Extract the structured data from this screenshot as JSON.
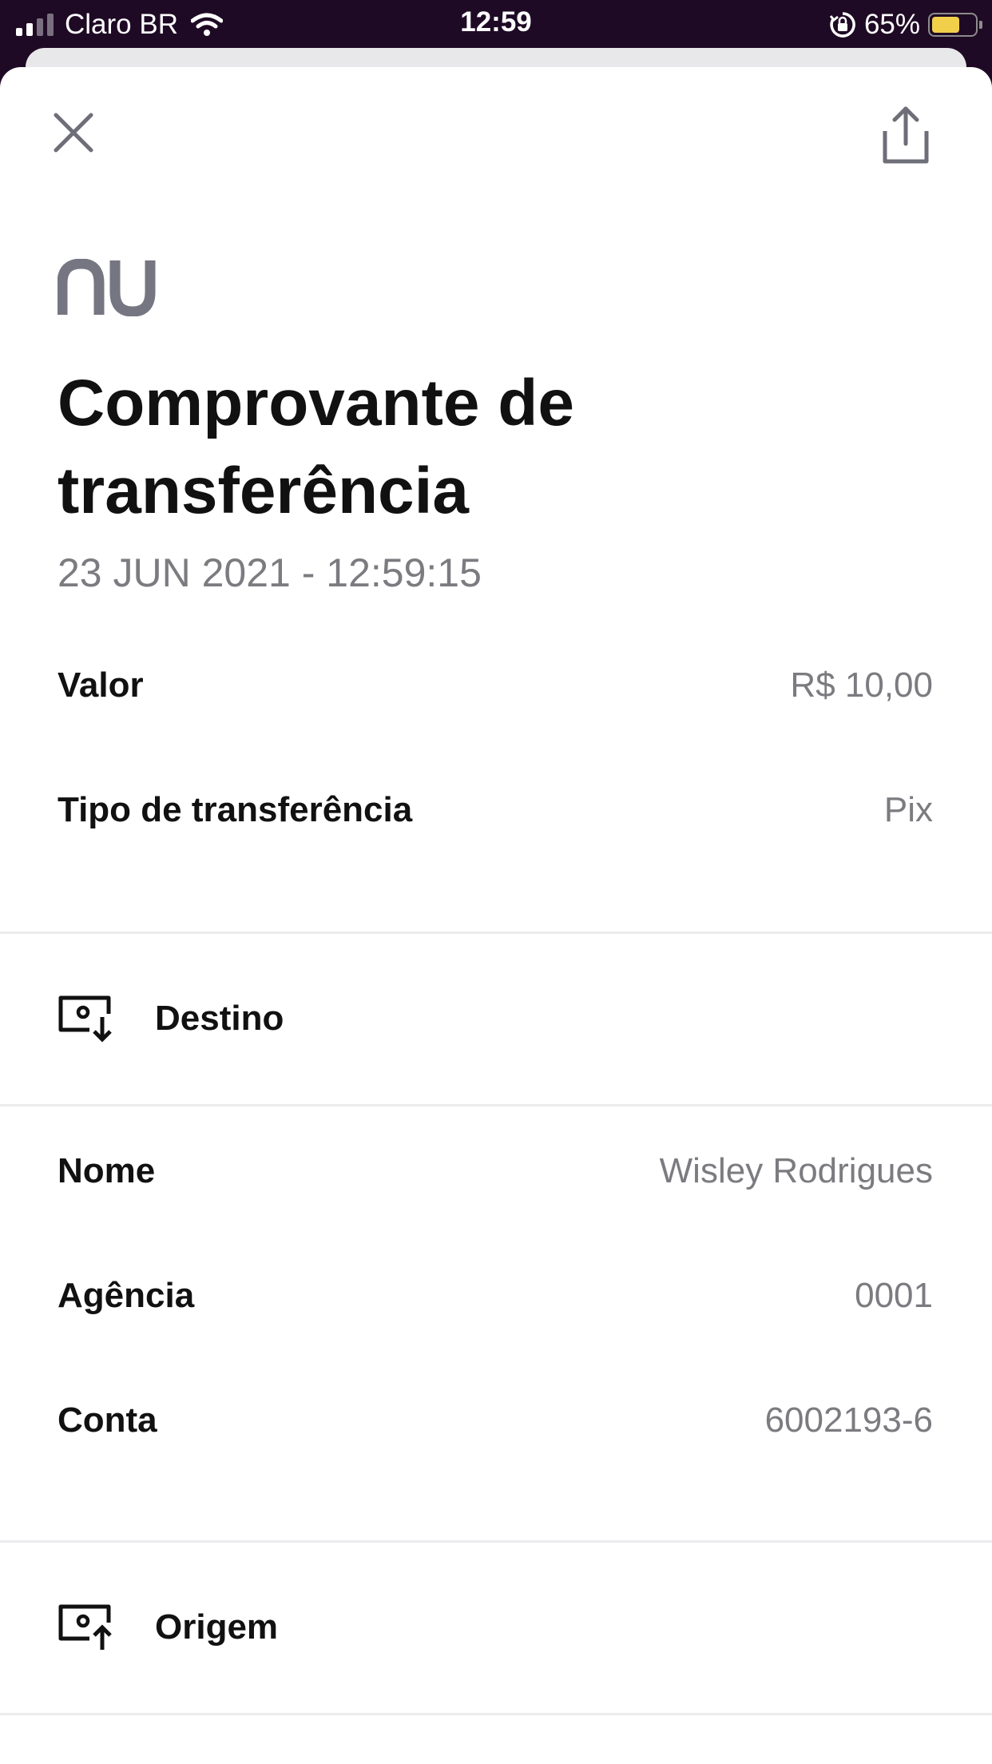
{
  "status_bar": {
    "carrier": "Claro BR",
    "time": "12:59",
    "battery_percent": "65%",
    "battery_level": 0.65,
    "signal_bars_filled": 2,
    "signal_bars_total": 4,
    "battery_color": "#f2cf4a"
  },
  "header": {
    "close_icon": "close-icon",
    "share_icon": "share-icon"
  },
  "brand": {
    "logo_text": "nu",
    "logo_color": "#767683"
  },
  "receipt": {
    "title": "Comprovante de transferência",
    "datetime": "23 JUN 2021 - 12:59:15",
    "summary": [
      {
        "label": "Valor",
        "value": "R$ 10,00"
      },
      {
        "label": "Tipo de transferência",
        "value": "Pix"
      }
    ],
    "destino": {
      "heading": "Destino",
      "icon": "money-in-icon",
      "fields": [
        {
          "label": "Nome",
          "value": "Wisley Rodrigues"
        },
        {
          "label": "Agência",
          "value": "0001"
        },
        {
          "label": "Conta",
          "value": "6002193-6"
        }
      ]
    },
    "origem": {
      "heading": "Origem",
      "icon": "money-out-icon"
    }
  }
}
